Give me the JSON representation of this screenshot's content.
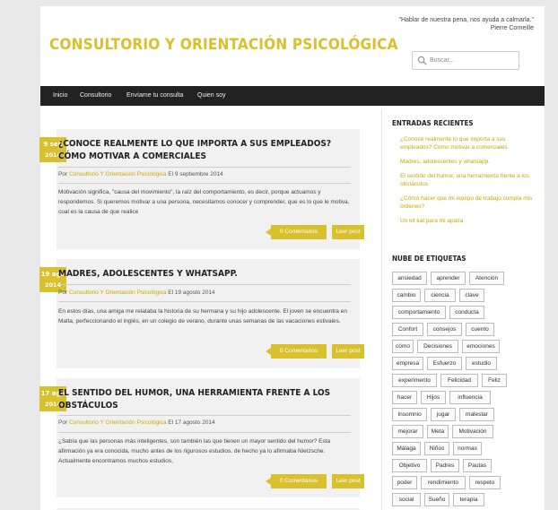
{
  "site": {
    "title": "CONSULTORIO Y ORIENTACIÓN PSICOLÓGICA",
    "quote_line1": "\"Hablar de nuestra pena, nos ayuda a calmarla.\"",
    "quote_line2": "Pierre Corneille",
    "search_placeholder": "Buscar..."
  },
  "nav": [
    "Inicio",
    "Consultorio",
    "Envíame tu consulta",
    "Quien soy"
  ],
  "posts": [
    {
      "day": "9 sep",
      "year": "2014",
      "title": "¿CONOCE REALMENTE LO QUE IMPORTA A SUS EMPLEADOS? CÓMO MOTIVAR A COMERCIALES",
      "by": "Por",
      "author": "Consultorio Y Orientación Psicológica",
      "date": "El 9 septiembre 2014",
      "excerpt": "Motivación significa, \"causa del movimiento\", la raíz del comportamiento, es decir, porque actuamos y respondemos. Si queremos motivar a una persona, necesitamos conocer y comprender, que es lo que le motiva, cual es la causa de que realice",
      "comments": "0 Comentarios",
      "more": "Leer post"
    },
    {
      "day": "19 ago",
      "year": "2014",
      "title": "MADRES, ADOLESCENTES Y WHATSAPP.",
      "by": "Por",
      "author": "Consultorio Y Orientación Psicológica",
      "date": "El 19 agosto 2014",
      "excerpt": "En estos días, una amiga me relataba la historia de su hermana y su hijo adolescente. El joven se encuentra en Malta, perfeccionando el inglés, en un colegio de verano, durante unas semanas de las vacaciones estivales.",
      "comments": "0 Comentarios",
      "more": "Leer post"
    },
    {
      "day": "17 ago",
      "year": "2014",
      "title": "EL SENTIDO DEL HUMOR, UNA HERRAMIENTA FRENTE A LOS OBSTÁCULOS",
      "by": "Por",
      "author": "Consultorio Y Orientación Psicológica",
      "date": "El 17 agosto 2014",
      "excerpt": "¿Sabía que las personas más inteligentes, son también las que tienen un mayor sentido del humor? Esta afirmación ya era conocida, mucho antes de los rigurosos estudios, de hecho ya lo afirmaba Nietzsche. Actualmente encontramos muchos estudios,",
      "comments": "0 Comentarios",
      "more": "Leer post"
    }
  ],
  "sidebar": {
    "recent_title": "ENTRADAS RECIENTES",
    "recent": [
      "¿Conoce realmente lo que importa a sus empleados? Cómo motivar a comerciales",
      "Madres, adolescentes y whatsapp.",
      "El sentido del humor, una herramienta frente a los obstáculos",
      "¿Cómo hacer que mi equipo de trabajo cumpla mis órdenes?",
      "Un kit kat para mi apatía"
    ],
    "tags_title": "NUBE DE ETIQUETAS",
    "tags": [
      [
        "ansiedad",
        "aprender",
        "Atención"
      ],
      [
        "cambio",
        "ciencia",
        "clave"
      ],
      [
        "comportamiento",
        "conducta"
      ],
      [
        "Confort",
        "consejos",
        "cuento"
      ],
      [
        "cómo",
        "Decisiones",
        "emociones"
      ],
      [
        "empresa",
        "Esfuerzo",
        "estudio"
      ],
      [
        "experimento",
        "Felicidad",
        "Feliz"
      ],
      [
        "hacer",
        "Hijos",
        "influencia"
      ],
      [
        "Insomnio",
        "jugar",
        "malestar"
      ],
      [
        "mejorar",
        "Meta",
        "Motivación"
      ],
      [
        "Málaga",
        "Niños",
        "normas"
      ],
      [
        "Objetivo",
        "Padres",
        "Pautas"
      ],
      [
        "poder",
        "rendimiento",
        "respeto"
      ],
      [
        "social",
        "Sueño",
        "terapia"
      ]
    ]
  }
}
